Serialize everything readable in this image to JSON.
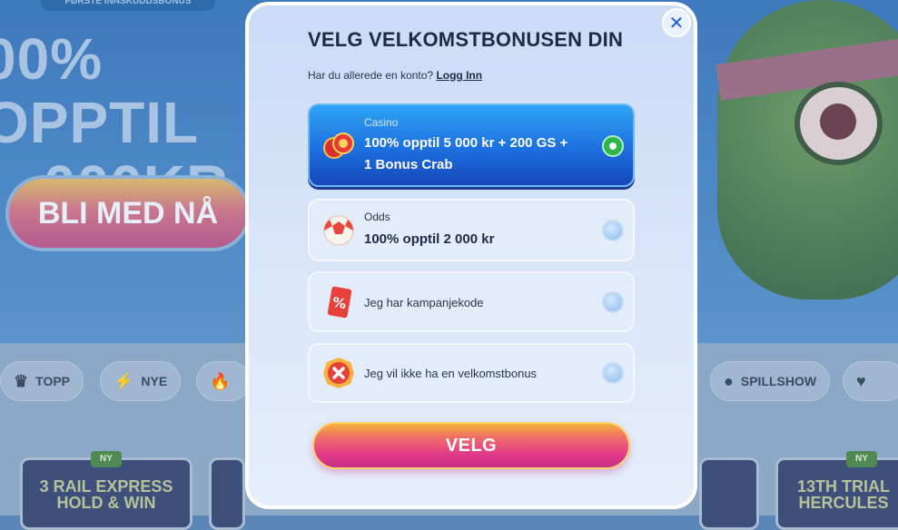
{
  "background": {
    "promo_tag": "FØRSTE INNSKUDDSBONUS",
    "headline_line1": "00% OPPTIL",
    "headline_line2": "000KR",
    "cta_label": "BLI MED NÅ",
    "categories": [
      {
        "label": "TOPP",
        "icon": "crown-icon"
      },
      {
        "label": "NYE",
        "icon": "lightning-icon"
      },
      {
        "label": "",
        "icon": "flame-icon"
      },
      {
        "label": "SPILLSHOW",
        "icon": "orange-icon"
      },
      {
        "label": "",
        "icon": "heart-icon"
      }
    ],
    "tiles": [
      {
        "title": "3 RAIL EXPRESS HOLD & WIN",
        "badge": "NY"
      },
      {
        "title": "",
        "badge": ""
      },
      {
        "title": "",
        "badge": ""
      },
      {
        "title": "13TH TRIAL HERCULES",
        "badge": "NY"
      }
    ]
  },
  "modal": {
    "title": "VELG VELKOMSTBONUSEN DIN",
    "login_prompt": "Har du allerede en konto?",
    "login_link": "Logg Inn",
    "options": [
      {
        "category": "Casino",
        "line1": "100% opptil 5 000 kr + 200 GS +",
        "line2": "1 Bonus Crab",
        "icon": "casino-chips-icon",
        "selected": true
      },
      {
        "category": "Odds",
        "line1": "100% opptil 2 000 kr",
        "icon": "football-icon",
        "selected": false
      },
      {
        "text": "Jeg har kampanjekode",
        "icon": "promo-ticket-icon",
        "selected": false
      },
      {
        "text": "Jeg vil ikke ha en velkomstbonus",
        "icon": "decline-icon",
        "selected": false
      }
    ],
    "submit_label": "VELG",
    "close_glyph": "✕"
  },
  "colors": {
    "selected_option": "#1d6fe0",
    "radio_on": "#2db54a",
    "submit_start": "#f2b03a",
    "submit_end": "#c72f86"
  }
}
